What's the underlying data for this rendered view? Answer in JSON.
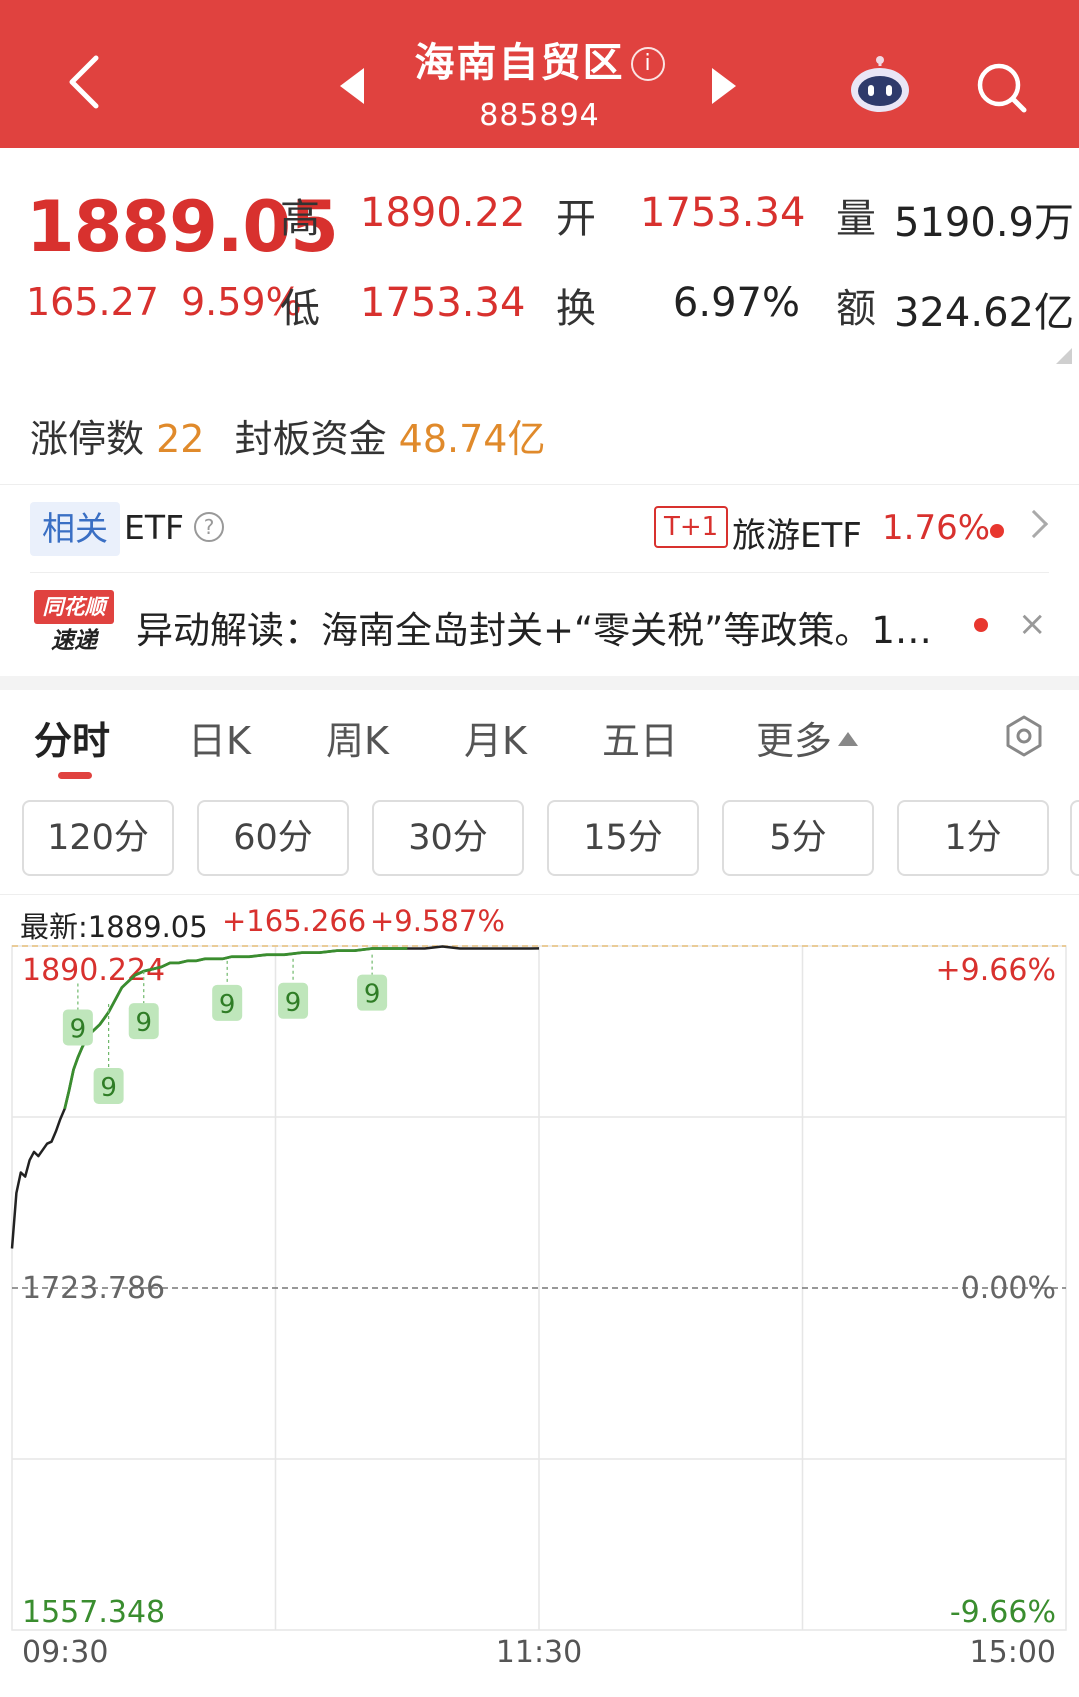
{
  "header": {
    "title": "海南自贸区",
    "info_symbol": "i",
    "code": "885894"
  },
  "quote": {
    "price": "1889.05",
    "change": "165.27",
    "change_pct": "9.59%",
    "high_label": "高",
    "high": "1890.22",
    "open_label": "开",
    "open": "1753.34",
    "volume_label": "量",
    "volume": "5190.9万",
    "low_label": "低",
    "low": "1753.34",
    "turnover_label": "换",
    "turnover": "6.97%",
    "amount_label": "额",
    "amount": "324.62亿"
  },
  "limit_up": {
    "count_label": "涨停数",
    "count": "22",
    "fund_label": "封板资金",
    "fund": "48.74亿"
  },
  "etf": {
    "tag": "相关",
    "label": "ETF",
    "help_symbol": "?",
    "settle": "T+1",
    "name": "旅游ETF",
    "pct": "1.76%"
  },
  "news": {
    "logo_top": "同花顺",
    "logo_bottom": "速递",
    "text": "异动解读：海南全岛封关+“零关税”等政策。1…",
    "close": "×"
  },
  "tabs": {
    "items": [
      "分时",
      "日K",
      "周K",
      "月K",
      "五日",
      "更多"
    ],
    "active": 0
  },
  "intervals": [
    "120分",
    "60分",
    "30分",
    "15分",
    "5分",
    "1分"
  ],
  "chart_info": {
    "latest": "最新:1889.05",
    "change": "+165.266",
    "pct": "+9.587%"
  },
  "chart_data": {
    "type": "line",
    "title": "",
    "xlabel": "",
    "ylabel": "",
    "x_ticks": [
      "09:30",
      "11:30",
      "15:00"
    ],
    "y_left_ticks": [
      "1890.224",
      "1723.786",
      "1557.348"
    ],
    "y_right_ticks": [
      "+9.66%",
      "0.00%",
      "-9.66%"
    ],
    "ylim": [
      1557.348,
      1890.224
    ],
    "prev_close": 1723.786,
    "limit_up_markers": [
      {
        "minute": 15,
        "value": 1872,
        "label": "9"
      },
      {
        "minute": 22,
        "value": 1862,
        "label": "9"
      },
      {
        "minute": 30,
        "value": 1878,
        "label": "9"
      },
      {
        "minute": 49,
        "value": 1883,
        "label": "9"
      },
      {
        "minute": 64,
        "value": 1884,
        "label": "9"
      },
      {
        "minute": 82,
        "value": 1886,
        "label": "9"
      }
    ],
    "series": [
      {
        "color": "#222222",
        "x_minutes": [
          0,
          1,
          2,
          3,
          4,
          5,
          6,
          7,
          8,
          9,
          10,
          11,
          12,
          13,
          14,
          15,
          16,
          17,
          18,
          19,
          20,
          21,
          22,
          23,
          24,
          25,
          26,
          27,
          28,
          29,
          30,
          32,
          34,
          36,
          38,
          40,
          42,
          44,
          46,
          48,
          50,
          54,
          58,
          62,
          66,
          70,
          74,
          78,
          82,
          86,
          90,
          94,
          98,
          102,
          106,
          110,
          114,
          118,
          120
        ],
        "values": [
          1743,
          1770,
          1780,
          1778,
          1786,
          1790,
          1788,
          1791,
          1794,
          1795,
          1800,
          1806,
          1811,
          1820,
          1830,
          1836,
          1841,
          1845,
          1848,
          1850,
          1852,
          1855,
          1858,
          1862,
          1866,
          1870,
          1872,
          1874,
          1876,
          1877,
          1878,
          1879,
          1880,
          1882,
          1882,
          1883,
          1883,
          1884,
          1884,
          1884,
          1885,
          1885,
          1886,
          1886,
          1887,
          1887,
          1888,
          1888,
          1889,
          1889,
          1889,
          1889,
          1890,
          1889,
          1889,
          1889,
          1889,
          1889,
          1889.05
        ]
      }
    ]
  }
}
